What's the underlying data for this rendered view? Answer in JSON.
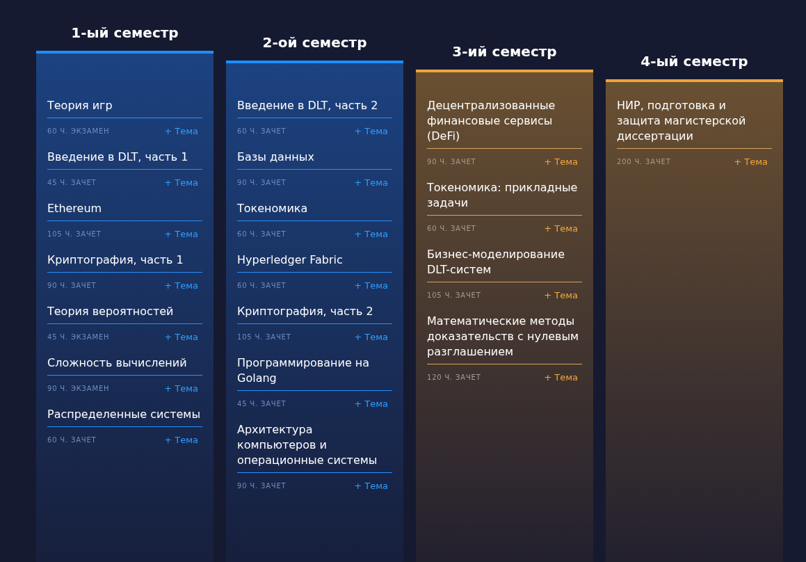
{
  "semesters": [
    {
      "title": "1-ый семестр",
      "kind": "blue",
      "courses": [
        {
          "name": "Теория игр",
          "meta": "60 Ч. ЭКЗАМЕН",
          "link": "+ Тема"
        },
        {
          "name": "Введение в DLT, часть 1",
          "meta": "45 Ч. ЗАЧЕТ",
          "link": "+ Тема"
        },
        {
          "name": "Ethereum",
          "meta": "105 Ч. ЗАЧЕТ",
          "link": "+ Тема"
        },
        {
          "name": "Криптография, часть 1",
          "meta": "90 Ч. ЗАЧЕТ",
          "link": "+ Тема"
        },
        {
          "name": "Теория вероятностей",
          "meta": "45 Ч. ЭКЗАМЕН",
          "link": "+ Тема"
        },
        {
          "name": "Сложность вычислений",
          "meta": "90 Ч. ЭКЗАМЕН",
          "link": "+ Тема"
        },
        {
          "name": "Распределенные системы",
          "meta": "60 Ч. ЗАЧЕТ",
          "link": "+ Тема"
        }
      ]
    },
    {
      "title": "2-ой семестр",
      "kind": "blue",
      "courses": [
        {
          "name": "Введение в DLT, часть 2",
          "meta": "60 Ч. ЗАЧЕТ",
          "link": "+ Тема"
        },
        {
          "name": "Базы данных",
          "meta": "90 Ч. ЗАЧЕТ",
          "link": "+ Тема"
        },
        {
          "name": "Токеномика",
          "meta": "60 Ч. ЗАЧЕТ",
          "link": "+ Тема"
        },
        {
          "name": "Hyperledger Fabric",
          "meta": "60 Ч. ЗАЧЕТ",
          "link": "+ Тема"
        },
        {
          "name": "Криптография, часть 2",
          "meta": "105 Ч. ЗАЧЕТ",
          "link": "+ Тема"
        },
        {
          "name": "Программирование на Golang",
          "meta": "45 Ч. ЗАЧЕТ",
          "link": "+ Тема"
        },
        {
          "name": "Архитектура компьютеров и операционные системы",
          "meta": "90 Ч. ЗАЧЕТ",
          "link": "+ Тема"
        }
      ]
    },
    {
      "title": "3-ий семестр",
      "kind": "orange",
      "courses": [
        {
          "name": "Децентрализованные финансовые сервисы (DeFi)",
          "meta": "90 Ч. ЗАЧЕТ",
          "link": "+ Тема"
        },
        {
          "name": "Токеномика: прикладные задачи",
          "meta": "60 Ч. ЗАЧЕТ",
          "link": "+ Тема"
        },
        {
          "name": "Бизнес-моделирование DLT-систем",
          "meta": "105 Ч. ЗАЧЕТ",
          "link": "+ Тема"
        },
        {
          "name": "Математические методы доказательств с нулевым разглашением",
          "meta": "120 Ч. ЗАЧЕТ",
          "link": "+ Тема"
        }
      ]
    },
    {
      "title": "4-ый семестр",
      "kind": "orange",
      "courses": [
        {
          "name": "НИР, подготовка и защита магистерской диссертации",
          "meta": "200 Ч. ЗАЧЕТ",
          "link": "+ Тема"
        }
      ]
    }
  ]
}
